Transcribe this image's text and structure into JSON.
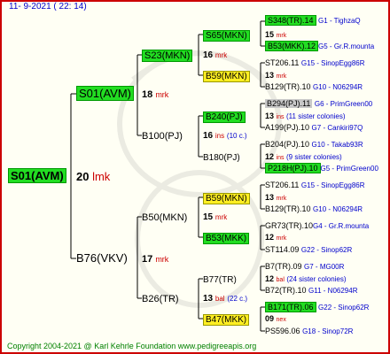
{
  "header": {
    "date": "11-  9-2021 (  22:  14)"
  },
  "footer": {
    "copyright": "Copyright 2004-2021 @ Karl Kehrle Foundation    www.pedigreeapis.org"
  },
  "root": {
    "name": "S01(AVM)",
    "num": "20",
    "abbr": "lmk"
  },
  "gen1": [
    {
      "name": "S01(AVM)",
      "num": "18",
      "abbr": "mrk"
    },
    {
      "name": "B76(VKV)",
      "num": "17",
      "abbr": "mrk"
    }
  ],
  "gen2": [
    {
      "name": "S23(MKN)",
      "num": "16",
      "abbr": "mrk",
      "note": ""
    },
    {
      "name": "B100(PJ)",
      "num": "16",
      "abbr": "ins",
      "note": "(10 c.)"
    },
    {
      "name": "B50(MKN)",
      "num": "15",
      "abbr": "mrk",
      "note": ""
    },
    {
      "name": "B26(TR)",
      "num": "13",
      "abbr": "bal",
      "note": "(22 c.)"
    }
  ],
  "gen3": [
    {
      "name": "S65(MKN)",
      "num": "15",
      "abbr": "mrk"
    },
    {
      "name": "B59(MKN)",
      "num": "13",
      "abbr": "mrk"
    },
    {
      "name": "B240(PJ)",
      "num": "13",
      "abbr": "ins",
      "note": "(11 sister colonies)"
    },
    {
      "name": "B180(PJ)",
      "num": "12",
      "abbr": "ins",
      "note": "(9 sister colonies)"
    },
    {
      "name": "B59(MKN)",
      "num": "13",
      "abbr": "mrk"
    },
    {
      "name": "B53(MKK)",
      "num": "12",
      "abbr": "mrk"
    },
    {
      "name": "B77(TR)",
      "num": "12",
      "abbr": "bal",
      "note": "(24 sister colonies)"
    },
    {
      "name": "B47(MKK)",
      "num": "09",
      "abbr": "nex"
    }
  ],
  "gen4": [
    {
      "name": "S348(TR).14",
      "info": "G1 - TighzaQ"
    },
    {
      "name": "B53(MKK).12",
      "info": "G5 - Gr.R.mounta"
    },
    {
      "name": "ST206.11",
      "info": "G15 - SinopEgg86R"
    },
    {
      "name": "B129(TR).10",
      "info": "G10 - N06294R"
    },
    {
      "name": "B294(PJ).11",
      "info": "G6 - PrimGreen00"
    },
    {
      "name": "A199(PJ).10",
      "info": "G7 - Cankiri97Q"
    },
    {
      "name": "B204(PJ).10",
      "info": "G10 - Takab93R"
    },
    {
      "name": "P218H(PJ).10",
      "info": "G5 - PrimGreen00"
    },
    {
      "name": "ST206.11",
      "info": "G15 - SinopEgg86R"
    },
    {
      "name": "B129(TR).10",
      "info": "G10 - N06294R"
    },
    {
      "name": "GR73(TR).10",
      "info": "G4 - Gr.R.mounta"
    },
    {
      "name": "ST114.09",
      "info": "G22 - Sinop62R"
    },
    {
      "name": "B7(TR).09",
      "info": "G7 - MG00R"
    },
    {
      "name": "B72(TR).10",
      "info": "G11 - N06294R"
    },
    {
      "name": "B171(TR).06",
      "info": "G22 - Sinop62R"
    },
    {
      "name": "PS596.06",
      "info": "G18 - Sinop72R"
    }
  ]
}
